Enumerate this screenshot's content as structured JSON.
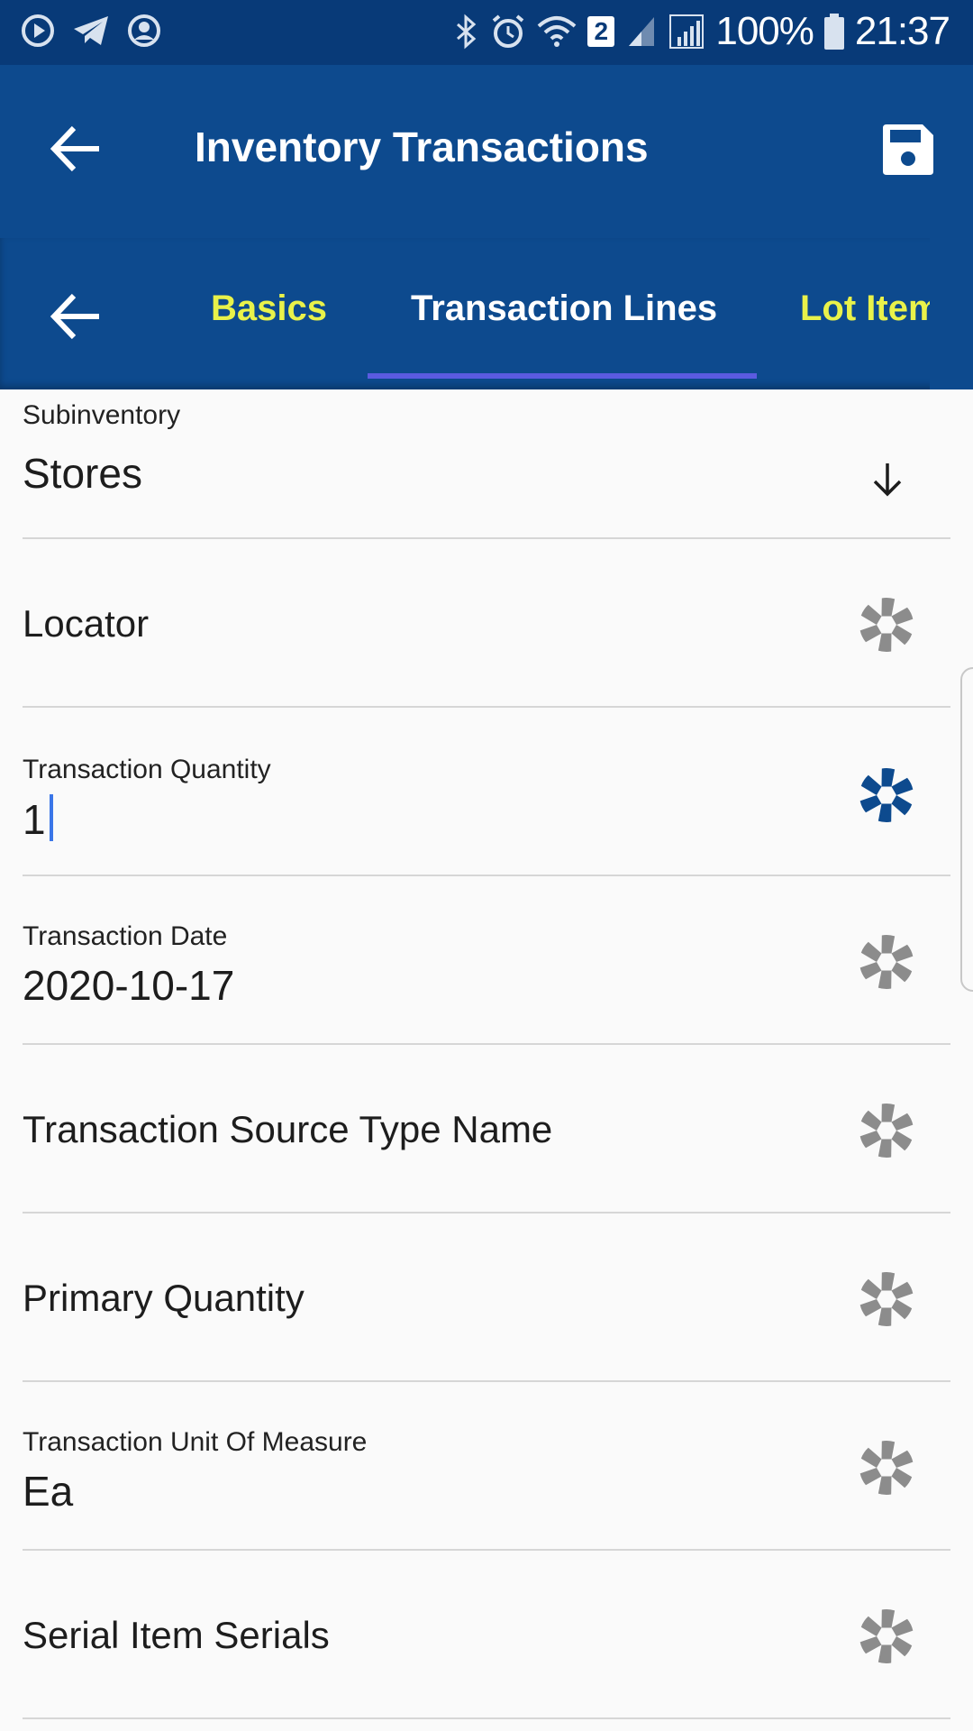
{
  "status_bar": {
    "battery": "100%",
    "time": "21:37",
    "badge": "2",
    "icons": [
      "play-circle-icon",
      "telegram-icon",
      "account-circle-icon",
      "bluetooth-icon",
      "alarm-icon",
      "wifi-icon",
      "signal-icon",
      "signal-roaming-icon",
      "battery-icon"
    ]
  },
  "app_bar": {
    "title": "Inventory Transactions",
    "back_icon": "arrow-left-icon",
    "save_icon": "save-icon"
  },
  "tabs": {
    "back_icon": "arrow-left-icon",
    "items": [
      {
        "label": "Basics",
        "active": false
      },
      {
        "label": "Transaction Lines",
        "active": true
      },
      {
        "label": "Lot Item",
        "active": false
      }
    ],
    "colors": {
      "active": "#ffffff",
      "inactive": "#e9f24a",
      "indicator": "#5b5be0"
    }
  },
  "form": {
    "subinventory": {
      "label": "Subinventory",
      "value": "Stores",
      "icon": "arrow-down-icon"
    },
    "locator": {
      "label": "Locator",
      "icon": "camera-aperture-icon"
    },
    "transaction_quantity": {
      "label": "Transaction Quantity",
      "value": "1",
      "icon": "camera-aperture-icon",
      "icon_color": "#0d4a8e"
    },
    "transaction_date": {
      "label": "Transaction Date",
      "value": "2020-10-17",
      "icon": "camera-aperture-icon"
    },
    "transaction_source_type_name": {
      "label": "Transaction Source Type Name",
      "icon": "camera-aperture-icon"
    },
    "primary_quantity": {
      "label": "Primary Quantity",
      "icon": "camera-aperture-icon"
    },
    "transaction_uom": {
      "label": "Transaction Unit Of Measure",
      "value": "Ea",
      "icon": "camera-aperture-icon"
    },
    "serial_item_serials": {
      "label": "Serial Item Serials",
      "icon": "camera-aperture-icon"
    }
  },
  "colors": {
    "header": "#0d4a8e",
    "status_bar": "#083a78",
    "icon_inactive": "#8c8c8c",
    "cursor": "#3a76e8"
  }
}
